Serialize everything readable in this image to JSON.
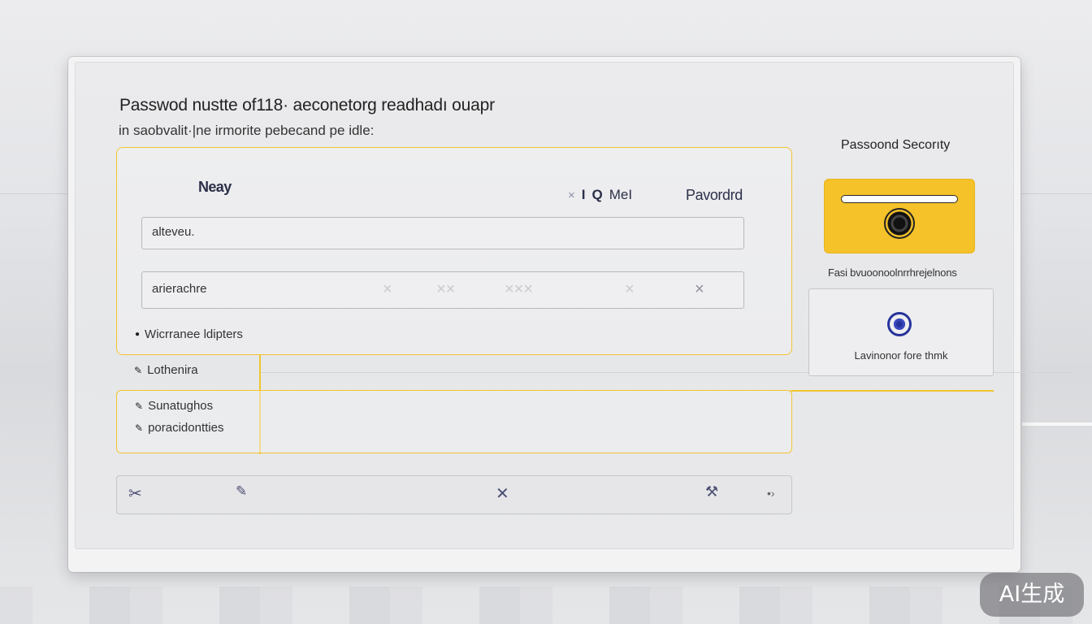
{
  "dialog": {
    "title": "Passwod  nustte of118· aeconetorg  readhadı ouapr",
    "subtitle": "in saobvalit·|ne irmorite pebecand pe idle:"
  },
  "form": {
    "label": "Neay",
    "tools": {
      "x": "×",
      "one": "I",
      "search": "Q",
      "mode": "MeI"
    },
    "password_label": "Pavordrd",
    "field1_value": "alteveu.",
    "field2_value": "arierachre",
    "field2_marks": [
      "×",
      "××",
      "×××",
      "×",
      "×"
    ],
    "bullets": [
      {
        "icon": "dot-icon",
        "label": "Wicrranee ldipters"
      },
      {
        "icon": "pencil-icon",
        "label": "Lothenira"
      }
    ]
  },
  "options": {
    "items": [
      {
        "icon": "pencil-icon",
        "label": "Sunatughos"
      },
      {
        "icon": "pencil-icon",
        "label": "poracidontties"
      }
    ]
  },
  "toolbar": {
    "icons": [
      "scissors-icon",
      "pencil-icon",
      "close-icon",
      "tools-icon",
      "chevron-right-icon"
    ]
  },
  "security": {
    "title": "Passoond Secorıty",
    "caption": "Fasi bvuoonoolnrrhrejelnons",
    "mode_label": "Lavinonor fore thmk"
  },
  "watermark": "AI生成",
  "colors": {
    "accent_yellow": "#f2c530",
    "card_yellow": "#f5c22a",
    "icon_blue": "#26339a"
  }
}
